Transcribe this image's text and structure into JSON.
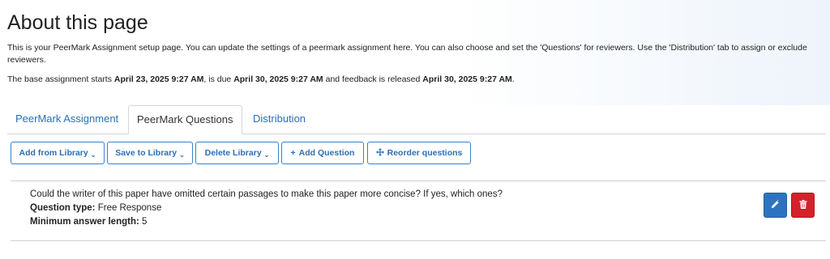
{
  "page": {
    "title": "About this page",
    "intro": "This is your PeerMark Assignment setup page. You can update the settings of a peermark assignment here. You can also choose and set the 'Questions' for reviewers. Use the 'Distribution' tab to assign or exclude reviewers.",
    "dates": {
      "prefix": "The base assignment starts ",
      "start": "April 23, 2025 9:27 AM",
      "mid": ", is due ",
      "due": "April 30, 2025 9:27 AM",
      "mid2": " and feedback is released ",
      "release": "April 30, 2025 9:27 AM",
      "suffix": "."
    }
  },
  "tabs": [
    {
      "label": "PeerMark Assignment",
      "active": false
    },
    {
      "label": "PeerMark Questions",
      "active": true
    },
    {
      "label": "Distribution",
      "active": false
    }
  ],
  "toolbar": {
    "add_from_library": "Add from Library",
    "save_to_library": "Save to Library",
    "delete_library": "Delete Library",
    "add_question": "Add Question",
    "reorder_questions": "Reorder questions"
  },
  "question": {
    "text": "Could the writer of this paper have omitted certain passages to make this paper more concise? If yes, which ones?",
    "type_label": "Question type:",
    "type_value": "Free Response",
    "min_label": "Minimum answer length:",
    "min_value": "5"
  },
  "icons": {
    "edit": "pencil-icon",
    "delete": "trash-icon",
    "caret": "caret-down-icon",
    "plus": "plus-icon",
    "move": "move-arrows-icon"
  },
  "colors": {
    "link": "#2a6fb8",
    "edit_button": "#2d74c0",
    "delete_button": "#d3222a"
  }
}
